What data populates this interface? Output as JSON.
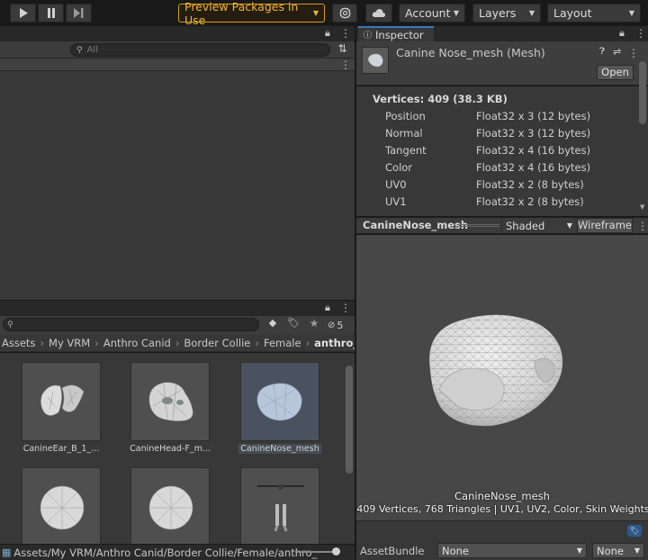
{
  "toolbar": {
    "preview_packages": "Preview Packages in Use",
    "account": "Account",
    "layers": "Layers",
    "layout": "Layout"
  },
  "hierarchy": {
    "search_placeholder": "All"
  },
  "project": {
    "hidden_count": "5",
    "breadcrumb": [
      "Assets",
      "My VRM",
      "Anthro Canid",
      "Border Collie",
      "Female",
      "anthro_fe"
    ],
    "assets": [
      {
        "label": "CanineEar_B_1_...",
        "selected": false
      },
      {
        "label": "CanineHead-F_m...",
        "selected": false
      },
      {
        "label": "CanineNose_mesh",
        "selected": true
      },
      {
        "label": "",
        "selected": false
      },
      {
        "label": "",
        "selected": false
      },
      {
        "label": "",
        "selected": false
      }
    ],
    "status_path": "Assets/My VRM/Anthro Canid/Border Collie/Female/anthro_"
  },
  "inspector": {
    "tab_label": "Inspector",
    "asset_title": "Canine Nose_mesh (Mesh)",
    "open_label": "Open",
    "vertices_heading": "Vertices: 409 (38.3 KB)",
    "attributes": [
      {
        "name": "Position",
        "format": "Float32 x 3 (12 bytes)"
      },
      {
        "name": "Normal",
        "format": "Float32 x 3 (12 bytes)"
      },
      {
        "name": "Tangent",
        "format": "Float32 x 4 (16 bytes)"
      },
      {
        "name": "Color",
        "format": "Float32 x 4 (16 bytes)"
      },
      {
        "name": "UV0",
        "format": "Float32 x 2 (8 bytes)"
      },
      {
        "name": "UV1",
        "format": "Float32 x 2 (8 bytes)"
      }
    ],
    "preview_title": "CanineNose_mesh",
    "shading_mode": "Shaded",
    "wireframe_label": "Wireframe",
    "preview_caption_name": "CanineNose_mesh",
    "preview_caption_stats": "409 Vertices, 768 Triangles | UV1, UV2, Color, Skin Weights",
    "assetbundle_label": "AssetBundle",
    "assetbundle_value": "None",
    "assetbundle_variant": "None"
  },
  "colors": {
    "preview_accent": "#d79b1b",
    "panel_bg": "#383838",
    "tab_bg": "#282828",
    "selection": "#4a5260"
  }
}
